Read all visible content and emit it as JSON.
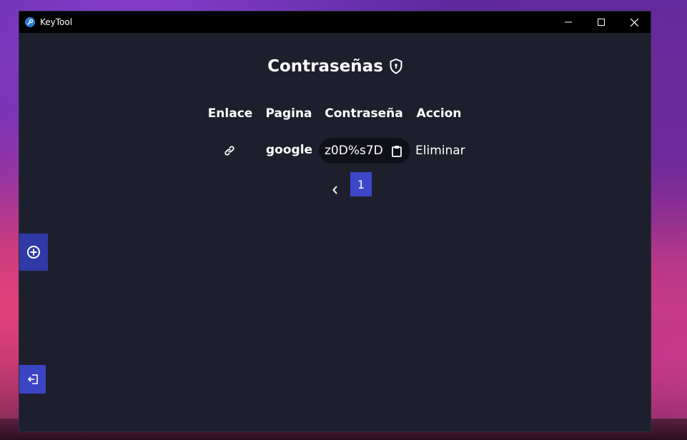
{
  "window": {
    "title": "KeyTool",
    "app_icon": "key-icon",
    "controls": [
      "minimize-icon",
      "maximize-icon",
      "close-icon"
    ]
  },
  "page": {
    "title": "Contraseñas",
    "title_icon": "shield-icon"
  },
  "table": {
    "headers": [
      "Enlace",
      "Pagina",
      "Contraseña",
      "Accion"
    ],
    "rows": [
      {
        "link_icon": "link-icon",
        "page": "google",
        "password": "z0D%s7D",
        "copy_icon": "clipboard-icon",
        "action": "Eliminar"
      }
    ]
  },
  "pagination": {
    "prev_icon": "chevron-left-icon",
    "current_page": "1"
  },
  "sidebar": {
    "add_icon": "plus-circle-icon",
    "logout_icon": "logout-icon"
  },
  "colors": {
    "background": "#1e1f2d",
    "titlebar": "#000000",
    "accent": "#3d47c9",
    "password_pill": "#0f1019"
  }
}
